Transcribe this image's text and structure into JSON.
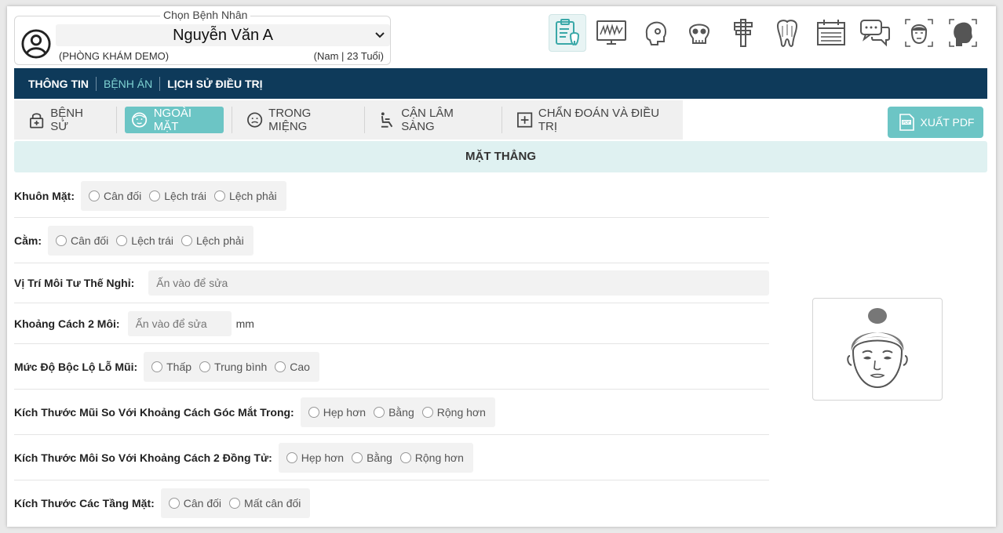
{
  "patient": {
    "legend": "Chọn Bệnh Nhân",
    "name": "Nguyễn Văn A",
    "clinic": "(PHÒNG KHÁM DEMO)",
    "demographics": "(Nam | 23 Tuổi)"
  },
  "top_icons": [
    "clipboard-tooth-icon",
    "xray-monitor-icon",
    "skull-profile-icon",
    "skull-front-icon",
    "caliper-icon",
    "tooth-icon",
    "calendar-icon",
    "chat-icon",
    "face-front-icon",
    "face-side-icon"
  ],
  "nav": {
    "items": [
      "THÔNG TIN",
      "BỆNH ÁN",
      "LỊCH SỬ ĐIỀU TRỊ"
    ],
    "active": "BỆNH ÁN"
  },
  "tabs": [
    {
      "label": "BỆNH SỬ",
      "icon": "lock-icon"
    },
    {
      "label": "NGOÀI MẶT",
      "icon": "face-icon",
      "active": true
    },
    {
      "label": "TRONG MIỆNG",
      "icon": "mouth-icon"
    },
    {
      "label": "CẬN LÂM SÀNG",
      "icon": "chair-icon"
    },
    {
      "label": "CHẨN ĐOÁN VÀ ĐIỀU TRỊ",
      "icon": "plus-square-icon"
    }
  ],
  "export_pdf": "XUẤT PDF",
  "section_title": "MẶT THẲNG",
  "fields": {
    "face_shape": {
      "label": "Khuôn Mặt:",
      "options": [
        "Cân đối",
        "Lệch trái",
        "Lệch phải"
      ]
    },
    "chin": {
      "label": "Cằm:",
      "options": [
        "Cân đối",
        "Lệch trái",
        "Lệch phải"
      ]
    },
    "lip_rest": {
      "label": "Vị Trí Môi Tư Thế Nghỉ:",
      "placeholder": "Ấn vào để sửa"
    },
    "lip_gap": {
      "label": "Khoảng Cách 2 Môi:",
      "placeholder": "Ấn vào để sửa",
      "unit": "mm"
    },
    "nostril": {
      "label": "Mức Độ Bộc Lộ Lỗ Mũi:",
      "options": [
        "Thấp",
        "Trung bình",
        "Cao"
      ]
    },
    "nose_width": {
      "label": "Kích Thước Mũi So Với Khoảng Cách Góc Mắt Trong:",
      "options": [
        "Hẹp hơn",
        "Bằng",
        "Rộng hơn"
      ]
    },
    "lip_width": {
      "label": "Kích Thước Môi So Với Khoảng Cách 2 Đồng Tử:",
      "options": [
        "Hẹp hơn",
        "Bằng",
        "Rộng hơn"
      ]
    },
    "face_levels": {
      "label": "Kích Thước Các Tầng Mặt:",
      "options": [
        "Cân đối",
        "Mất cân đối"
      ]
    }
  }
}
